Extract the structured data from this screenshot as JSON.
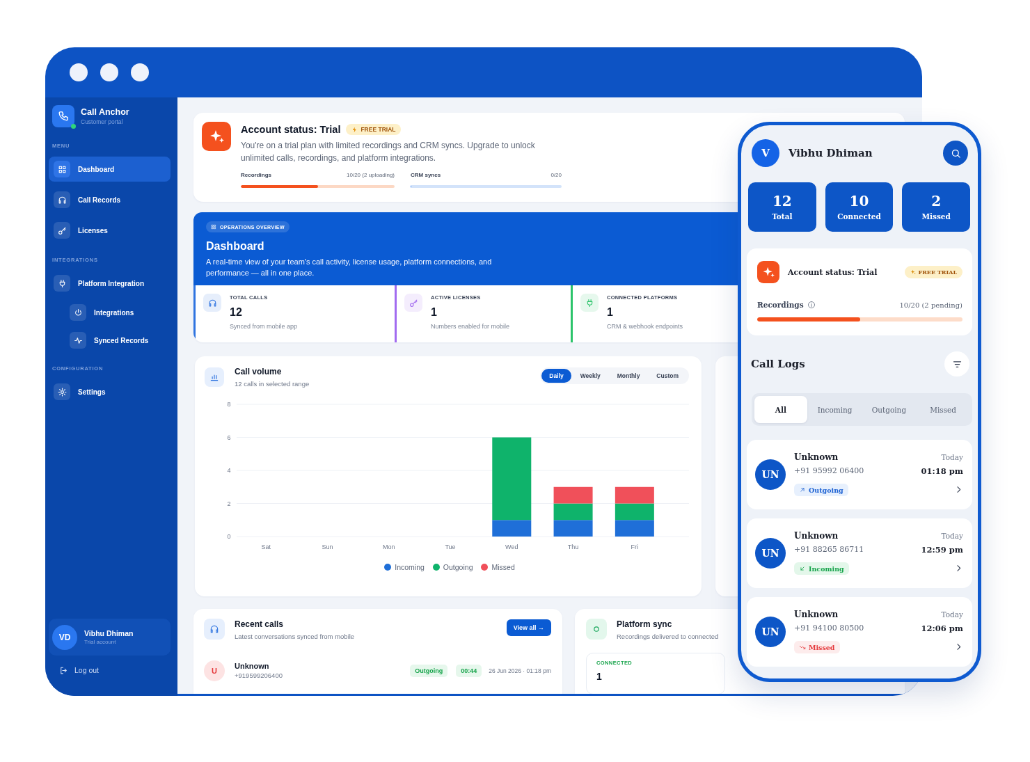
{
  "sidebar": {
    "brand": {
      "name": "Call Anchor",
      "subtitle": "Customer portal",
      "online": true
    },
    "sections": [
      {
        "title": "MENU",
        "items": [
          {
            "label": "Dashboard",
            "selected": true
          },
          {
            "label": "Call Records",
            "selected": false
          },
          {
            "label": "Licenses",
            "selected": false
          }
        ]
      },
      {
        "title": "INTEGRATIONS",
        "items": [
          {
            "label": "Platform Integration",
            "selected": false,
            "children": [
              {
                "label": "Integrations",
                "selected": false
              },
              {
                "label": "Synced Records",
                "selected": false
              }
            ]
          }
        ]
      },
      {
        "title": "CONFIGURATION",
        "items": [
          {
            "label": "Settings",
            "selected": false
          }
        ]
      }
    ],
    "user": {
      "initials": "VD",
      "name": "Vibhu Dhiman",
      "plan": "Trial account"
    },
    "logout": "Log out"
  },
  "account_status": {
    "title": "Account status: Trial",
    "badge": "FREE TRIAL",
    "description": "You're on a trial plan with limited recordings and CRM syncs. Upgrade to unlock unlimited calls, recordings, and platform integrations.",
    "meters": [
      {
        "label": "Recordings",
        "reading": "10/20 (2 uploading)",
        "level": 0.5
      },
      {
        "label": "CRM syncs",
        "reading": "0/20",
        "level": 0
      }
    ]
  },
  "overview": {
    "badge": "OPERATIONS OVERVIEW",
    "title": "Dashboard",
    "description": "A real-time view of your team's call activity, license usage, platform connections, and performance — all in one place.",
    "stats": [
      {
        "label": "TOTAL CALLS",
        "value": "12",
        "note": "Synced from mobile app",
        "color": "#2f74e0"
      },
      {
        "label": "ACTIVE LICENSES",
        "value": "1",
        "note": "Numbers enabled for mobile",
        "color": "#a26bf0"
      },
      {
        "label": "CONNECTED PLATFORMS",
        "value": "1",
        "note": "CRM & webhook endpoints",
        "color": "#2cc46b"
      }
    ]
  },
  "call_volume": {
    "title": "Call volume",
    "subtitle": "12 calls in selected range",
    "ranges": [
      {
        "label": "Daily",
        "selected": true
      },
      {
        "label": "Weekly",
        "selected": false
      },
      {
        "label": "Monthly",
        "selected": false
      },
      {
        "label": "Custom",
        "selected": false
      }
    ],
    "chart_data": {
      "type": "bar",
      "stacked": true,
      "categories": [
        "Sat",
        "Sun",
        "Mon",
        "Tue",
        "Wed",
        "Thu",
        "Fri"
      ],
      "series": [
        {
          "name": "Incoming",
          "color": "#1f6fd8",
          "values": [
            0,
            0,
            0,
            0,
            1,
            1,
            1
          ]
        },
        {
          "name": "Outgoing",
          "color": "#0fb36b",
          "values": [
            0,
            0,
            0,
            0,
            5,
            1,
            1
          ]
        },
        {
          "name": "Missed",
          "color": "#f0505a",
          "values": [
            0,
            0,
            0,
            0,
            0,
            1,
            1
          ]
        }
      ],
      "ylim": [
        0,
        8
      ],
      "yticks": [
        0,
        2,
        4,
        6,
        8
      ],
      "grid": true,
      "legend": "bottom"
    }
  },
  "recent_calls": {
    "title": "Recent calls",
    "subtitle": "Latest conversations synced from mobile",
    "action": "View all →",
    "rows": [
      {
        "initial": "U",
        "name": "Unknown",
        "number": "+919599206400",
        "direction": "Outgoing",
        "duration": "00:44",
        "time": "26 Jun 2026 · 01:18 pm"
      }
    ]
  },
  "platform_sync": {
    "title": "Platform sync",
    "subtitle": "Recordings delivered to connected",
    "stats": [
      {
        "label": "CONNECTED",
        "value": "1"
      }
    ]
  },
  "phone": {
    "user": {
      "initial": "V",
      "name": "Vibhu Dhiman"
    },
    "stats": [
      {
        "value": "12",
        "label": "Total"
      },
      {
        "value": "10",
        "label": "Connected"
      },
      {
        "value": "2",
        "label": "Missed"
      }
    ],
    "account": {
      "title": "Account status: Trial",
      "badge": "FREE TRIAL",
      "meter": {
        "label": "Recordings",
        "reading": "10/20 (2 pending)",
        "level": 0.5
      }
    },
    "call_logs": {
      "title": "Call Logs",
      "tabs": [
        {
          "label": "All",
          "selected": true
        },
        {
          "label": "Incoming",
          "selected": false
        },
        {
          "label": "Outgoing",
          "selected": false
        },
        {
          "label": "Missed",
          "selected": false
        }
      ],
      "items": [
        {
          "initials": "UN",
          "name": "Unknown",
          "number": "+91 95992 06400",
          "kind": "outgoing",
          "direction": "Outgoing",
          "day": "Today",
          "time": "01:18 pm"
        },
        {
          "initials": "UN",
          "name": "Unknown",
          "number": "+91 88265 86711",
          "kind": "incoming",
          "direction": "Incoming",
          "day": "Today",
          "time": "12:59 pm"
        },
        {
          "initials": "UN",
          "name": "Unknown",
          "number": "+91 94100 80500",
          "kind": "missed",
          "direction": "Missed",
          "day": "Today",
          "time": "12:06 pm"
        }
      ]
    }
  }
}
